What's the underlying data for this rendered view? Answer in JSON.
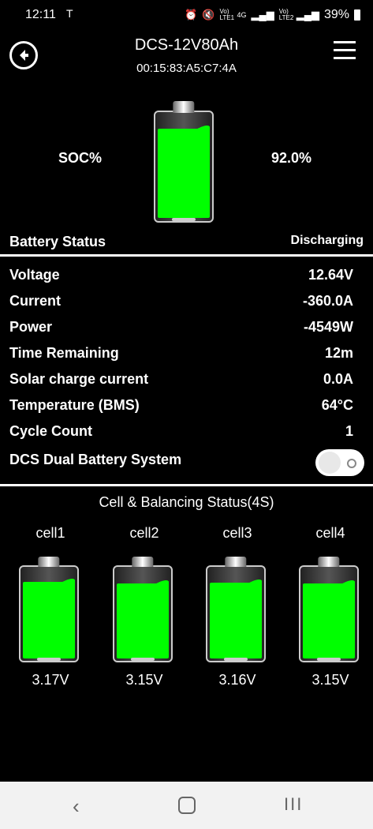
{
  "status_bar": {
    "time": "12:11",
    "notification": "T",
    "icons": [
      "alarm-icon",
      "mute-icon",
      "volte1-icon",
      "4g-icon",
      "signal-icon",
      "volte2-icon",
      "signal-icon"
    ],
    "volte1": "Vo) LTE1",
    "network": "4G",
    "volte2": "Vo) LTE2",
    "battery_percent": "39%"
  },
  "header": {
    "title": "DCS-12V80Ah",
    "mac": "00:15:83:A5:C7:4A"
  },
  "soc": {
    "label": "SOC%",
    "value": "92.0%",
    "level": 0.92
  },
  "battery_status": {
    "label": "Battery Status",
    "value": "Discharging"
  },
  "metrics": [
    {
      "label": "Voltage",
      "value": "12.64V"
    },
    {
      "label": "Current",
      "value": "-360.0A"
    },
    {
      "label": "Power",
      "value": "-4549W"
    },
    {
      "label": "Time Remaining",
      "value": "12m"
    },
    {
      "label": "Solar charge current",
      "value": "0.0A"
    },
    {
      "label": "Temperature (BMS)",
      "value": "64°C"
    },
    {
      "label": "Cycle Count",
      "value": "1"
    }
  ],
  "dual_battery": {
    "label": "DCS Dual Battery System",
    "enabled": false
  },
  "cells": {
    "title": "Cell & Balancing Status(4S)",
    "items": [
      {
        "name": "cell1",
        "voltage": "3.17V",
        "level": 0.9
      },
      {
        "name": "cell2",
        "voltage": "3.15V",
        "level": 0.88
      },
      {
        "name": "cell3",
        "voltage": "3.16V",
        "level": 0.89
      },
      {
        "name": "cell4",
        "voltage": "3.15V",
        "level": 0.88
      }
    ]
  },
  "nav": {
    "back": "‹",
    "recent": "III"
  },
  "colors": {
    "fill": "#00ff00",
    "background": "#000000"
  }
}
